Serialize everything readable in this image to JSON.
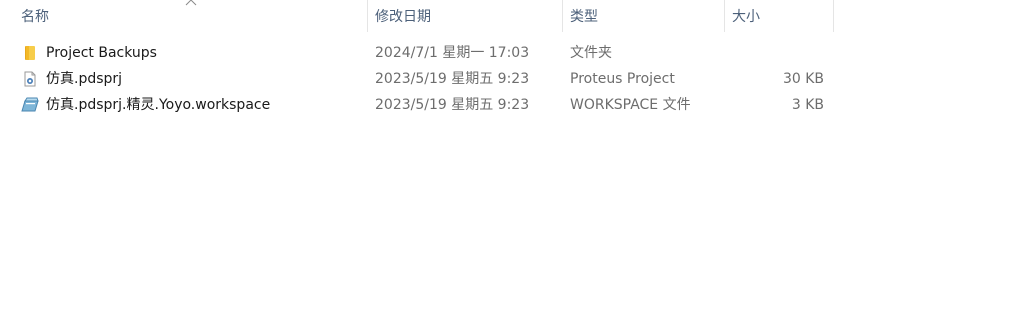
{
  "columns": {
    "name": "名称",
    "date": "修改日期",
    "type": "类型",
    "size": "大小"
  },
  "files": [
    {
      "icon": "folder-icon",
      "name": "Project Backups",
      "date": "2024/7/1 星期一 17:03",
      "type": "文件夹",
      "size": ""
    },
    {
      "icon": "proteus-project-file-icon",
      "name": "仿真.pdsprj",
      "date": "2023/5/19 星期五 9:23",
      "type": "Proteus Project",
      "size": "30 KB"
    },
    {
      "icon": "workspace-file-icon",
      "name": "仿真.pdsprj.精灵.Yoyo.workspace",
      "date": "2023/5/19 星期五 9:23",
      "type": "WORKSPACE 文件",
      "size": "3 KB"
    }
  ],
  "colors": {
    "header_text": "#4c607a",
    "secondary_text": "#6d6d6d",
    "folder_yellow": "#f5c842"
  }
}
